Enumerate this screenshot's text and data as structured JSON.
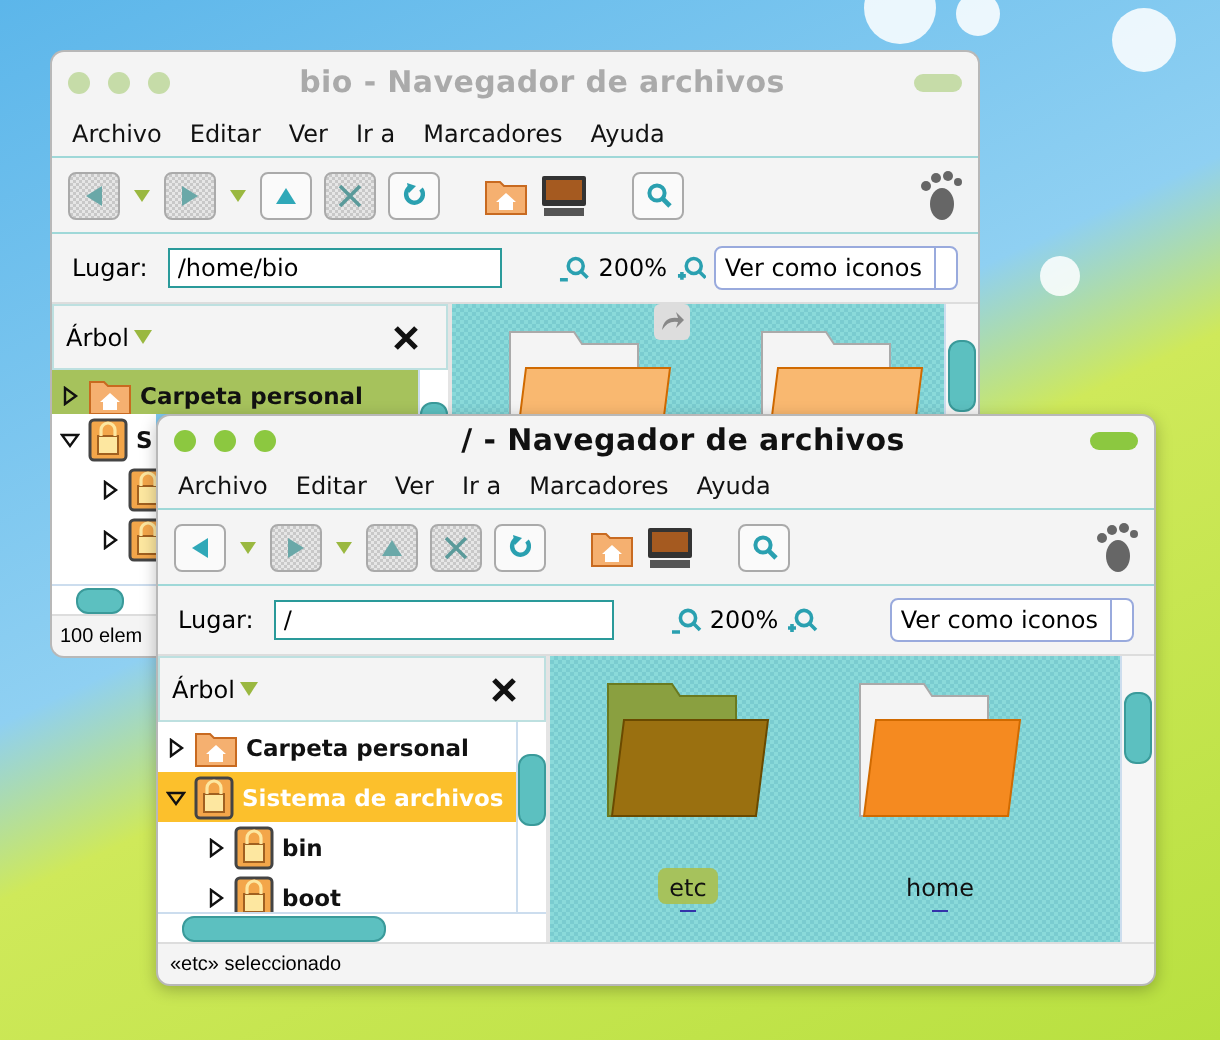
{
  "windows": [
    {
      "title": "bio - Navegador de archivos",
      "active": false,
      "menu": [
        "Archivo",
        "Editar",
        "Ver",
        "Ir a",
        "Marcadores",
        "Ayuda"
      ],
      "toolbar": [
        {
          "kind": "back",
          "disabled": true
        },
        {
          "kind": "dropdown"
        },
        {
          "kind": "forward",
          "disabled": true
        },
        {
          "kind": "dropdown"
        },
        {
          "kind": "up",
          "disabled": false
        },
        {
          "kind": "stop",
          "disabled": true
        },
        {
          "kind": "reload",
          "disabled": false
        },
        {
          "kind": "home"
        },
        {
          "kind": "computer"
        },
        {
          "kind": "search",
          "disabled": false
        }
      ],
      "location": {
        "label": "Lugar:",
        "value": "/home/bio"
      },
      "zoom": "200%",
      "view_mode": "Ver como iconos",
      "tree": {
        "title": "Árbol",
        "items": [
          {
            "name": "Carpeta personal",
            "kind": "home",
            "expanded": false,
            "selected": true
          },
          {
            "name": "S",
            "kind": "drive",
            "expanded": true,
            "selected": false,
            "children": [
              {
                "kind": "drive",
                "expanded": false,
                "selected": false
              },
              {
                "kind": "drive",
                "expanded": false,
                "selected": false
              }
            ]
          }
        ]
      },
      "icons": [
        {
          "kind": "plain",
          "link": true
        },
        {
          "kind": "plain",
          "link": false
        }
      ],
      "status": "100 elem"
    },
    {
      "title": "/ - Navegador de archivos",
      "active": true,
      "menu": [
        "Archivo",
        "Editar",
        "Ver",
        "Ir a",
        "Marcadores",
        "Ayuda"
      ],
      "toolbar": [
        {
          "kind": "back",
          "disabled": false
        },
        {
          "kind": "dropdown"
        },
        {
          "kind": "forward",
          "disabled": true
        },
        {
          "kind": "dropdown"
        },
        {
          "kind": "up",
          "disabled": true
        },
        {
          "kind": "stop",
          "disabled": true
        },
        {
          "kind": "reload",
          "disabled": false
        },
        {
          "kind": "home"
        },
        {
          "kind": "computer"
        },
        {
          "kind": "search",
          "disabled": false
        }
      ],
      "location": {
        "label": "Lugar:",
        "value": "/"
      },
      "zoom": "200%",
      "view_mode": "Ver como iconos",
      "tree": {
        "title": "Árbol",
        "items": [
          {
            "name": "Carpeta personal",
            "kind": "home",
            "expanded": false,
            "selected": false
          },
          {
            "name": "Sistema de archivos",
            "kind": "drive",
            "expanded": true,
            "selected": true,
            "children": [
              {
                "name": "bin",
                "kind": "drive",
                "expanded": false,
                "selected": false
              },
              {
                "name": "boot",
                "kind": "drive",
                "expanded": false,
                "selected": false
              }
            ]
          }
        ]
      },
      "icons": [
        {
          "name": "etc",
          "kind": "green",
          "link": false,
          "selected": true
        },
        {
          "name": "home",
          "kind": "orange",
          "link": false,
          "selected": false
        }
      ],
      "status": "«etc» seleccionado"
    }
  ]
}
